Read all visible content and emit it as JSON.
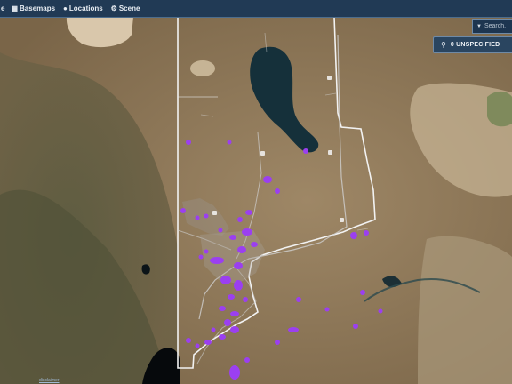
{
  "toolbar": {
    "items": [
      {
        "label": "e",
        "icon": "cut-off-icon"
      },
      {
        "label": "Basemaps",
        "icon": "basemaps-icon"
      },
      {
        "label": "Locations",
        "icon": "location-pin-icon"
      },
      {
        "label": "Scene",
        "icon": "scene-icon"
      }
    ]
  },
  "search": {
    "placeholder": "Search..."
  },
  "filter_badge": {
    "label": "0 UNSPECIFIED",
    "icon": "magnifier-icon"
  },
  "attribution": {
    "left": "disclaimer"
  },
  "colors": {
    "toolbar_bg": "#213a55",
    "terrain": "#8a7558",
    "lake": "#15303a",
    "boundary": "#f2f2f2",
    "marker": "#9b3ff0"
  }
}
